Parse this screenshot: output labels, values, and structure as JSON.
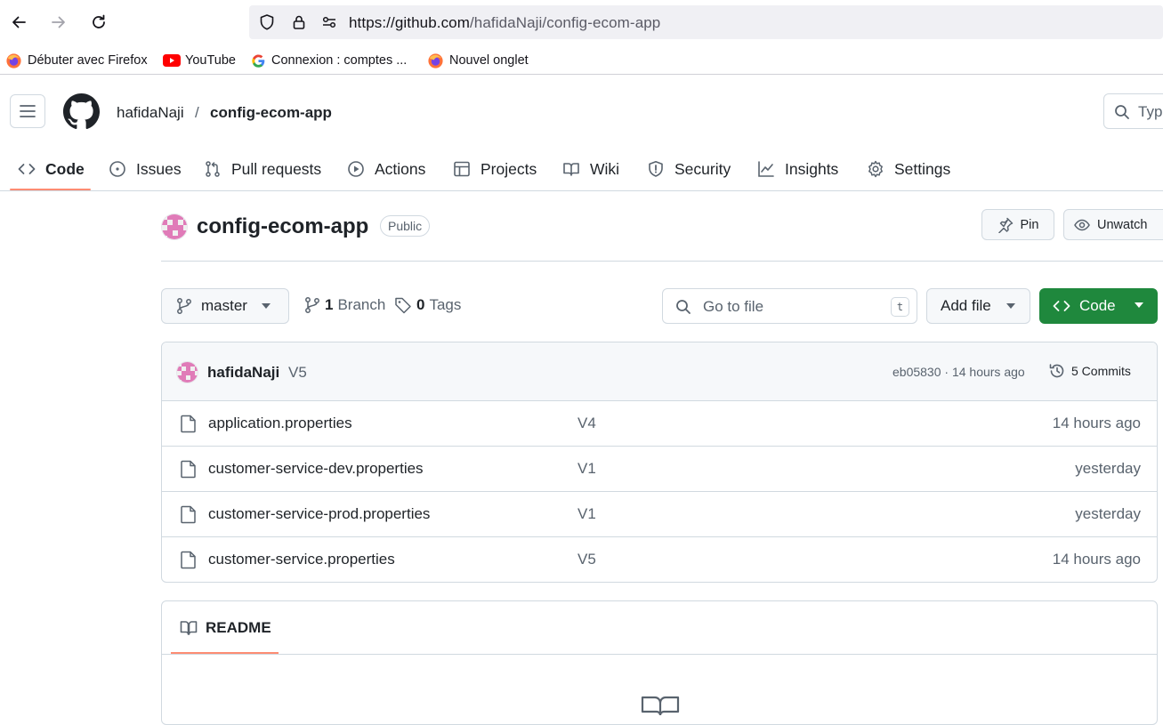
{
  "browser": {
    "url_host": "https://github.com",
    "url_path": "/hafidaNaji/config-ecom-app",
    "bookmarks": [
      {
        "label": "Débuter avec Firefox",
        "icon": "firefox-icon"
      },
      {
        "label": "YouTube",
        "icon": "youtube-icon"
      },
      {
        "label": "Connexion : comptes ...",
        "icon": "google-icon"
      },
      {
        "label": "Nouvel onglet",
        "icon": "firefox-icon"
      }
    ]
  },
  "header": {
    "owner": "hafidaNaji",
    "separator": "/",
    "repo": "config-ecom-app",
    "search_placeholder": "Type"
  },
  "nav": {
    "tabs": [
      {
        "label": "Code",
        "icon": "code-icon",
        "active": true
      },
      {
        "label": "Issues",
        "icon": "issue-icon"
      },
      {
        "label": "Pull requests",
        "icon": "pull-request-icon"
      },
      {
        "label": "Actions",
        "icon": "play-icon"
      },
      {
        "label": "Projects",
        "icon": "table-icon"
      },
      {
        "label": "Wiki",
        "icon": "book-icon"
      },
      {
        "label": "Security",
        "icon": "shield-icon"
      },
      {
        "label": "Insights",
        "icon": "graph-icon"
      },
      {
        "label": "Settings",
        "icon": "gear-icon"
      }
    ]
  },
  "repo": {
    "name": "config-ecom-app",
    "visibility": "Public",
    "pin_label": "Pin",
    "watch_label": "Unwatch"
  },
  "toolbar": {
    "branch": "master",
    "branch_count": "1",
    "branch_label": "Branch",
    "tag_count": "0",
    "tag_label": "Tags",
    "goto_placeholder": "Go to file",
    "goto_shortcut": "t",
    "add_file_label": "Add file",
    "code_label": "Code"
  },
  "commit": {
    "author": "hafidaNaji",
    "message": "V5",
    "meta": "eb05830 · 14 hours ago",
    "commits_label": "5 Commits"
  },
  "files": [
    {
      "name": "application.properties",
      "message": "V4",
      "date": "14 hours ago"
    },
    {
      "name": "customer-service-dev.properties",
      "message": "V1",
      "date": "yesterday"
    },
    {
      "name": "customer-service-prod.properties",
      "message": "V1",
      "date": "yesterday"
    },
    {
      "name": "customer-service.properties",
      "message": "V5",
      "date": "14 hours ago"
    }
  ],
  "readme": {
    "tab_label": "README"
  },
  "colors": {
    "primary_green": "#1f883d",
    "accent_underline": "#fd8c73",
    "border": "#d1d9e0",
    "muted_text": "#59636e"
  }
}
